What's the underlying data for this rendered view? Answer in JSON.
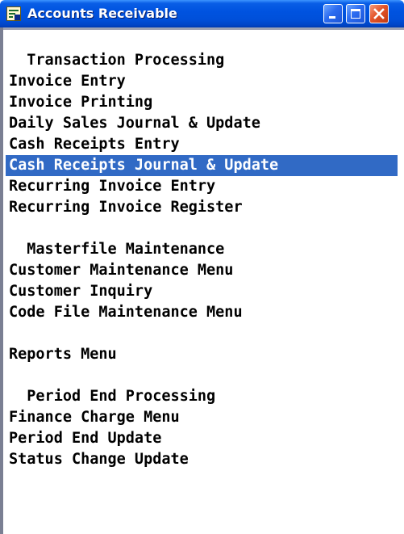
{
  "window": {
    "title": "Accounts Receivable",
    "controls": {
      "minimize_icon": "minimize-icon",
      "maximize_icon": "maximize-icon",
      "close_icon": "close-icon"
    },
    "colors": {
      "titlebar": "#0053e0",
      "selection": "#316ac5",
      "close_button": "#e3542a"
    }
  },
  "menu": {
    "sections": [
      {
        "heading": "Transaction Processing",
        "items": [
          {
            "label": "Invoice Entry"
          },
          {
            "label": "Invoice Printing"
          },
          {
            "label": "Daily Sales Journal & Update"
          },
          {
            "label": "Cash Receipts Entry"
          },
          {
            "label": "Cash Receipts Journal & Update",
            "selected": true
          },
          {
            "label": "Recurring Invoice Entry"
          },
          {
            "label": "Recurring Invoice Register"
          }
        ]
      },
      {
        "heading": "Masterfile Maintenance",
        "items": [
          {
            "label": "Customer Maintenance Menu"
          },
          {
            "label": "Customer Inquiry"
          },
          {
            "label": "Code File Maintenance Menu"
          }
        ]
      },
      {
        "heading": "",
        "items": [
          {
            "label": "Reports Menu"
          }
        ]
      },
      {
        "heading": "Period End Processing",
        "items": [
          {
            "label": "Finance Charge Menu"
          },
          {
            "label": "Period End Update"
          },
          {
            "label": "Status Change Update"
          }
        ]
      }
    ]
  }
}
